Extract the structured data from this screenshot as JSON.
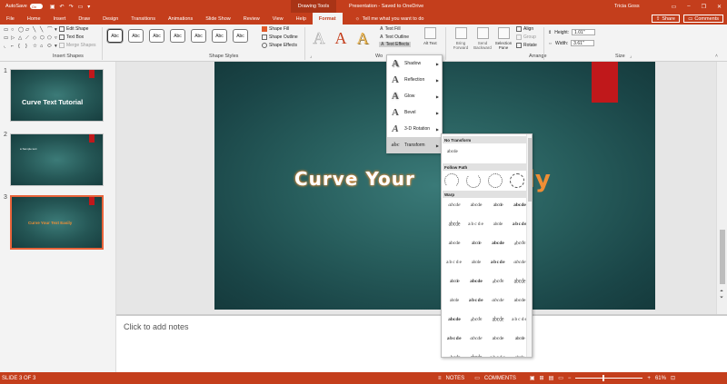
{
  "titlebar": {
    "autosave_label": "AutoSave",
    "autosave_state": "On",
    "context_tab_title": "Drawing Tools",
    "doc_title": "Presentation  -  Saved to OneDrive",
    "user": "Tricia Goss",
    "minimize": "–",
    "restore": "❐",
    "close": "✕"
  },
  "tabs": [
    "File",
    "Home",
    "Insert",
    "Draw",
    "Design",
    "Transitions",
    "Animations",
    "Slide Show",
    "Review",
    "View",
    "Help",
    "Format"
  ],
  "tell_me": "Tell me what you want to do",
  "share": "Share",
  "comments_btn": "Comments",
  "ribbon": {
    "insert_shapes": {
      "label": "Insert Shapes",
      "edit_shape": "Edit Shape",
      "text_box": "Text Box",
      "merge_shapes": "Merge Shapes",
      "shape_glyphs": [
        "▭",
        "○",
        "◯",
        "▱",
        "╲",
        "╲",
        "⌒",
        "▾",
        "▭",
        "▷",
        "△",
        "⟋",
        "◇",
        "⬡",
        "⬠",
        "▿",
        "◟",
        "⌐",
        "{",
        "}",
        "☆",
        "⌂",
        "⬭",
        "▾"
      ]
    },
    "shape_styles": {
      "label": "Shape Styles",
      "samples": [
        "Abc",
        "Abc",
        "Abc",
        "Abc",
        "Abc",
        "Abc",
        "Abc"
      ],
      "shape_fill": "Shape Fill",
      "shape_outline": "Shape Outline",
      "shape_effects": "Shape Effects"
    },
    "wordart": {
      "label": "Wo",
      "letters": [
        "A",
        "A",
        "A"
      ],
      "text_fill": "Text Fill",
      "text_outline": "Text Outline",
      "text_effects": "Text Effects"
    },
    "alt_text": "Alt Text",
    "arrange": {
      "label": "Arrange",
      "bring_forward": "Bring Forward",
      "send_backward": "Send Backward",
      "selection_pane": "Selection Pane",
      "align": "Align",
      "group": "Group",
      "rotate": "Rotate"
    },
    "size": {
      "label": "Size",
      "height_label": "Height:",
      "height": "1.01\"",
      "width_label": "Width:",
      "width": "3.61\""
    }
  },
  "slides": [
    {
      "number": "1",
      "title": "Curve Text Tutorial"
    },
    {
      "number": "2",
      "small_text": "● Sample text"
    },
    {
      "number": "3",
      "orange_text": "Curve Your Text Easily"
    }
  ],
  "slide": {
    "text": "Curve Your",
    "text_tail": "ly"
  },
  "notes_placeholder": "Click to add notes",
  "status": {
    "slide_of": "SLIDE 3 OF 3",
    "notes": "NOTES",
    "comments": "COMMENTS",
    "zoom": "61%"
  },
  "text_effects_menu": [
    {
      "label": "Shadow",
      "icon": "shadow-A-icon"
    },
    {
      "label": "Reflection",
      "icon": "reflection-A-icon"
    },
    {
      "label": "Glow",
      "icon": "glow-A-icon"
    },
    {
      "label": "Bevel",
      "icon": "bevel-A-icon"
    },
    {
      "label": "3-D Rotation",
      "icon": "3d-rotation-A-icon"
    },
    {
      "label": "Transform",
      "icon": "transform-abc-icon"
    }
  ],
  "transform_panel": {
    "no_transform_header": "No Transform",
    "no_transform_sample": "abcde",
    "follow_path_header": "Follow Path",
    "warp_header": "Warp",
    "warp_cells": [
      "abcde",
      "abcde",
      "abcde",
      "abcde",
      "abcde",
      "abcde",
      "abcde",
      "abcde",
      "abcde",
      "abcde",
      "abcde",
      "abcde",
      "abcde",
      "abcde",
      "abcde",
      "abcde",
      "abcde",
      "abcde",
      "abcde",
      "abcde",
      "abcde",
      "abcde",
      "abcde",
      "abcde",
      "abcde",
      "abcde",
      "abcde",
      "abcde",
      "abcde",
      "abcde",
      "abcde",
      "abcde",
      "abcde",
      "abcde",
      "abcde",
      "abcde"
    ]
  },
  "colors": {
    "accent": "#c43e1c",
    "slide_bg": "#275d5c",
    "red_block": "#c0181b",
    "orange_text": "#ef8e35"
  }
}
